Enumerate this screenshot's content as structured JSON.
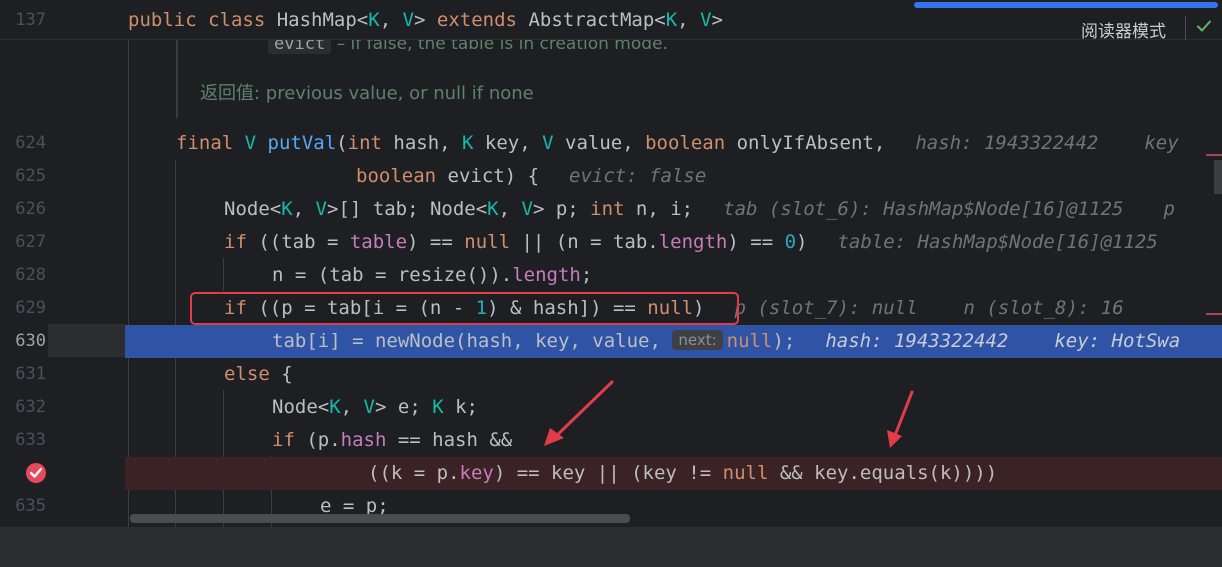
{
  "sticky": {
    "line_no": "137",
    "kw1": "public class ",
    "cls": "HashMap<",
    "k1": "K",
    "c1": ", ",
    "v1": "V",
    "c2": "> ",
    "kw2": "extends ",
    "base": "AbstractMap<",
    "k2": "K",
    "c3": ", ",
    "v2": "V",
    "c4": ">",
    "reader_mode": "阅读器模式"
  },
  "doc": {
    "cut_code": "evict",
    "cut_text": " – if false, the table is in creation mode.",
    "return_label": "返回值:",
    "return_text": " previous value, or null if none"
  },
  "lines": {
    "n624": "624",
    "n625": "625",
    "n626": "626",
    "n627": "627",
    "n628": "628",
    "n629": "629",
    "n630": "630",
    "n631": "631",
    "n632": "632",
    "n633": "633",
    "n635": "635",
    "l624": {
      "a": "final ",
      "b": "V ",
      "c": "putVal",
      "d": "(",
      "e": "int ",
      "f": "hash, ",
      "g": "K ",
      "h": "key, ",
      "i": "V ",
      "j": "value, ",
      "k": "boolean ",
      "l": "onlyIfAbsent,",
      "hint1": "hash: 1943322442",
      "hint2": "key"
    },
    "l625": {
      "a": "boolean ",
      "b": "evict) {",
      "hint": "evict: false"
    },
    "l626": {
      "a": "Node<",
      "b": "K",
      "c": ", ",
      "d": "V",
      "e": ">[] tab; Node<",
      "f": "K",
      "g": ", ",
      "h": "V",
      "i": "> p; ",
      "j": "int ",
      "k": "n, i;",
      "hint": "tab (slot_6): HashMap$Node[16]@1125",
      "hint2": "p"
    },
    "l627": {
      "a": "if ",
      "b": "((tab = ",
      "c": "table",
      "d": ") == ",
      "e": "null",
      "f": " || (n = tab.",
      "g": "length",
      "h": ") == ",
      "i": "0",
      "j": ")",
      "hint": "table: HashMap$Node[16]@1125"
    },
    "l628": {
      "a": "n = (tab = resize()).",
      "b": "length",
      "c": ";"
    },
    "l629": {
      "a": "if ",
      "b": "((p = tab[i = (n - ",
      "c": "1",
      "d": ") & hash]) == ",
      "e": "null",
      "f": ")",
      "hint1": "p (slot_7): null",
      "hint2": "n (slot_8): 16"
    },
    "l630": {
      "a": "tab[i] = newNode(hash, key, value, ",
      "pill": "next:",
      "b": "null",
      "c": ");",
      "hint1": "hash: 1943322442",
      "hint2": "key: HotSwa"
    },
    "l631": {
      "a": "else ",
      "b": "{"
    },
    "l632": {
      "a": "Node<",
      "b": "K",
      "c": ", ",
      "d": "V",
      "e": "> e; ",
      "f": "K",
      "g": " k;"
    },
    "l633": {
      "a": "if ",
      "b": "(p.",
      "c": "hash",
      "d": " == hash &&"
    },
    "l634": {
      "a": "((k = p.",
      "b": "key",
      "c": ") == key || (key != ",
      "d": "null",
      "e": " && key.equals(k))))"
    },
    "l635": {
      "a": "e = p;"
    }
  },
  "colors": {
    "background": "#1e1f22",
    "execution_line": "#2f54a6",
    "breakpoint_line": "#3b2224",
    "annotation_red": "#e33b4a",
    "keyword": "#cf8e6d",
    "type_param": "#16baac",
    "method": "#56a8f5",
    "field": "#c77dbb"
  },
  "icons": {
    "breakpoint": "breakpoint-check-icon",
    "reader_check": "check-icon",
    "arrows": "annotation-arrow-icon"
  }
}
